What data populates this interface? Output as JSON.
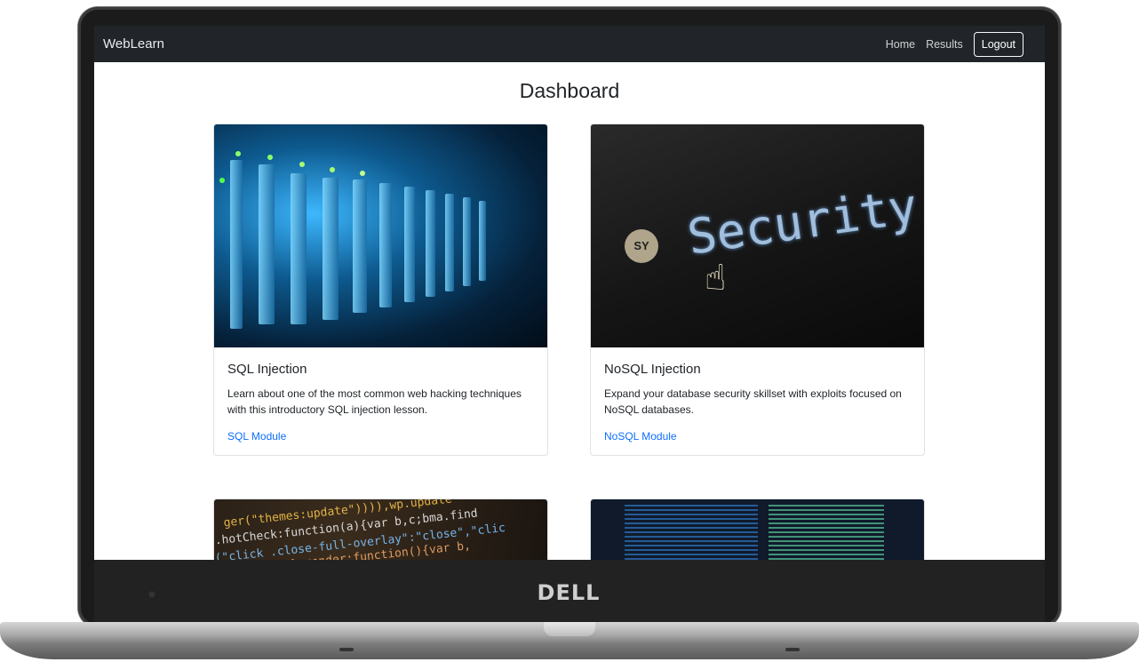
{
  "app": {
    "brand": "WebLearn",
    "nav": {
      "home": "Home",
      "results": "Results",
      "logout": "Logout"
    }
  },
  "page": {
    "title": "Dashboard"
  },
  "cards": [
    {
      "title": "SQL Injection",
      "text": "Learn about one of the most common web hacking techniques with this introductory SQL injection lesson.",
      "link": "SQL Module",
      "image": "server-rack-image"
    },
    {
      "title": "NoSQL Injection",
      "text": "Expand your database security skillset with exploits focused on NoSQL databases.",
      "link": "NoSQL Module",
      "image": "security-screen-image",
      "image_text": "Security"
    },
    {
      "image": "source-code-image"
    },
    {
      "image": "terminal-image"
    }
  ],
  "laptop": {
    "brand_logo": "DELL"
  },
  "colors": {
    "navbar": "#212529",
    "link": "#0d6efd",
    "border": "#dee2e6"
  }
}
